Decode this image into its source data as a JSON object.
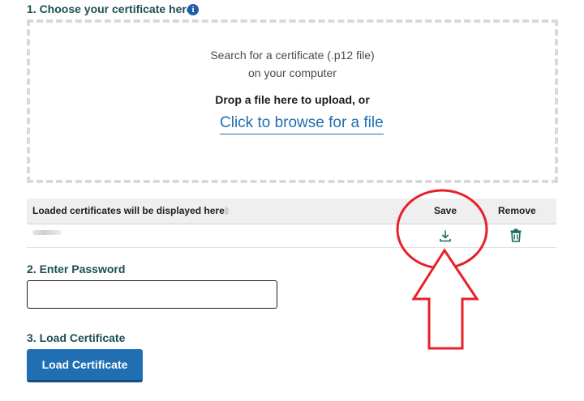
{
  "step1": {
    "heading": "1. Choose your certificate here:",
    "info_icon": "i"
  },
  "dropzone": {
    "search_line1": "Search for a certificate (.p12 file)",
    "search_line2": "on your computer",
    "drop_text": "Drop a file here to upload, or",
    "browse_link": "Click to browse for a file"
  },
  "table": {
    "headers": {
      "certificates": "Loaded certificates will be displayed here:",
      "save": "Save",
      "remove": "Remove"
    },
    "icons": {
      "sort": "sort-icon",
      "save": "download-icon",
      "remove": "trash-icon"
    }
  },
  "step2": {
    "heading": "2. Enter Password",
    "password_value": ""
  },
  "step3": {
    "heading": "3. Load Certificate",
    "button_label": "Load Certificate"
  },
  "colors": {
    "heading": "#1b4f52",
    "primary": "#1f6fb2",
    "annotation": "#e8202a"
  }
}
